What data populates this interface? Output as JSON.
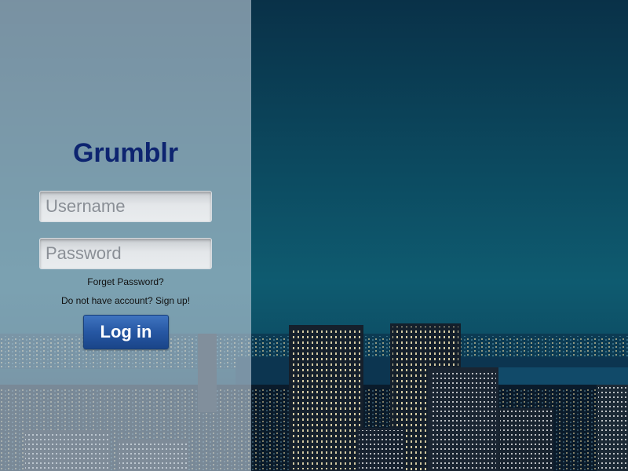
{
  "app": {
    "brand": "Grumblr"
  },
  "form": {
    "username_placeholder": "Username",
    "password_placeholder": "Password",
    "forget_password_label": "Forget Password?",
    "signup_label": "Do not have account? Sign up!",
    "login_label": "Log in"
  },
  "colors": {
    "brand": "#0d2470",
    "button": "#2657a3",
    "panel": "#becdda"
  }
}
